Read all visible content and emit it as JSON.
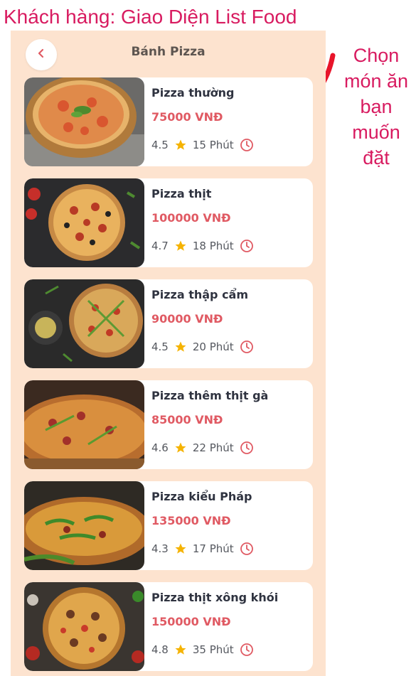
{
  "caption": "Khách hàng: Giao Diện List Food",
  "side_note": [
    "Chọn",
    "món ăn",
    "bạn",
    "muốn",
    "đặt"
  ],
  "header": {
    "title": "Bánh Pizza",
    "back_icon": "chevron-left-icon"
  },
  "colors": {
    "background": "#fde3cf",
    "price": "#e05a63",
    "star": "#f5b301",
    "clock": "#e05a63",
    "annotation": "#d81b60",
    "arrow": "#e8142a"
  },
  "items": [
    {
      "name": "Pizza thường",
      "price": "75000 VNĐ",
      "rating": "4.5",
      "time": "15 Phút"
    },
    {
      "name": "Pizza thịt",
      "price": "100000 VNĐ",
      "rating": "4.7",
      "time": "18 Phút"
    },
    {
      "name": "Pizza thập cẩm",
      "price": "90000 VNĐ",
      "rating": "4.5",
      "time": "20 Phút"
    },
    {
      "name": "Pizza thêm thịt gà",
      "price": "85000 VNĐ",
      "rating": "4.6",
      "time": "22 Phút"
    },
    {
      "name": "Pizza kiểu Pháp",
      "price": "135000 VNĐ",
      "rating": "4.3",
      "time": "17 Phút"
    },
    {
      "name": "Pizza thịt xông khói",
      "price": "150000 VNĐ",
      "rating": "4.8",
      "time": "35 Phút"
    }
  ]
}
